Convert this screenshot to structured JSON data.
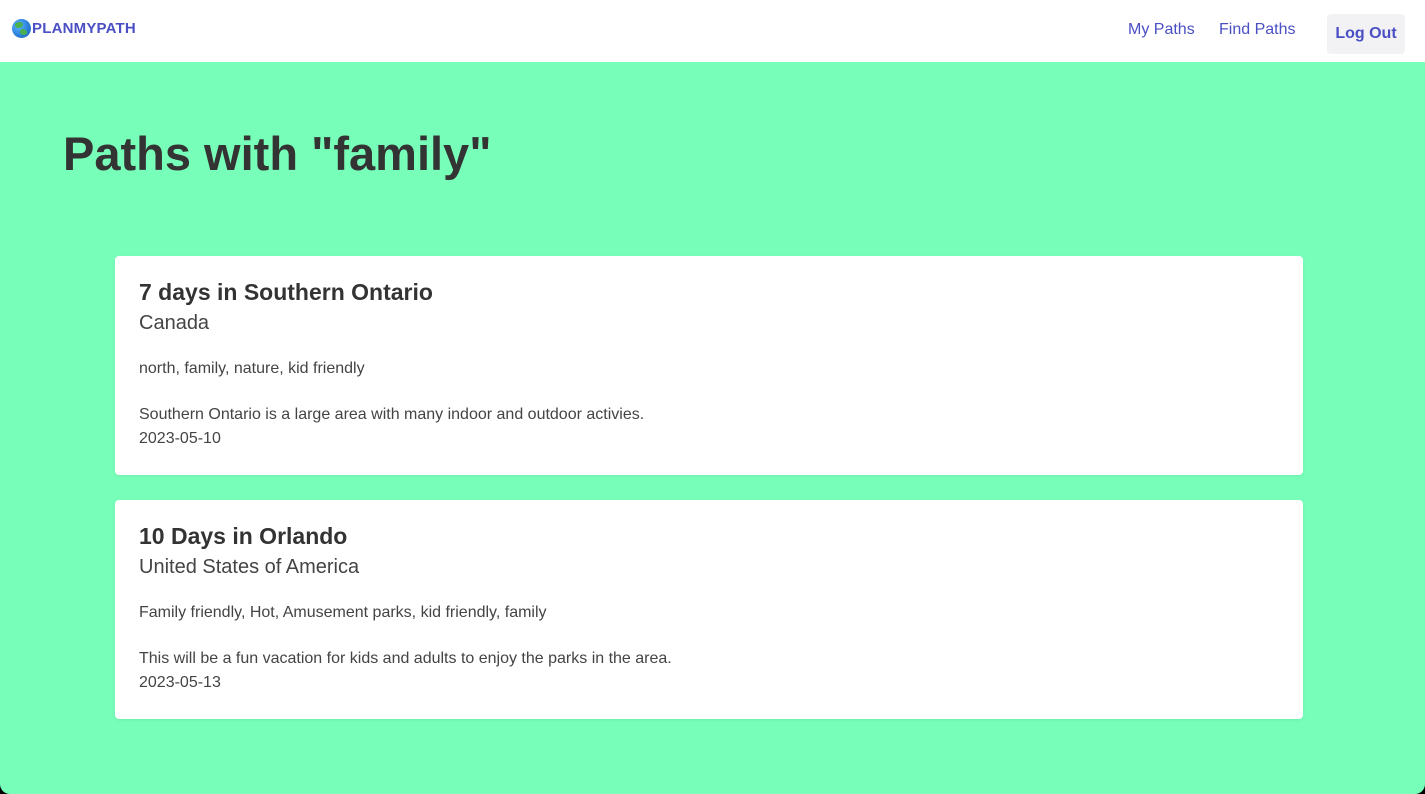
{
  "nav": {
    "brand": "PLANMYPATH",
    "brand_icon": "globe-icon",
    "links": [
      "My Paths",
      "Find Paths"
    ],
    "logout_label": "Log Out"
  },
  "page": {
    "title": "Paths with \"family\""
  },
  "paths": [
    {
      "title": "7 days in Southern Ontario",
      "country": "Canada",
      "tags": "north, family, nature, kid friendly",
      "description": "Southern Ontario is a large area with many indoor and outdoor activies.",
      "date": "2023-05-10"
    },
    {
      "title": "10 Days in Orlando",
      "country": "United States of America",
      "tags": "Family friendly, Hot, Amusement parks, kid friendly, family",
      "description": "This will be a fun vacation for kids and adults to enjoy the parks in the area.",
      "date": "2023-05-13"
    }
  ],
  "colors": {
    "background": "#77ffb9",
    "accent": "#4a4fc4",
    "text": "#333333"
  }
}
